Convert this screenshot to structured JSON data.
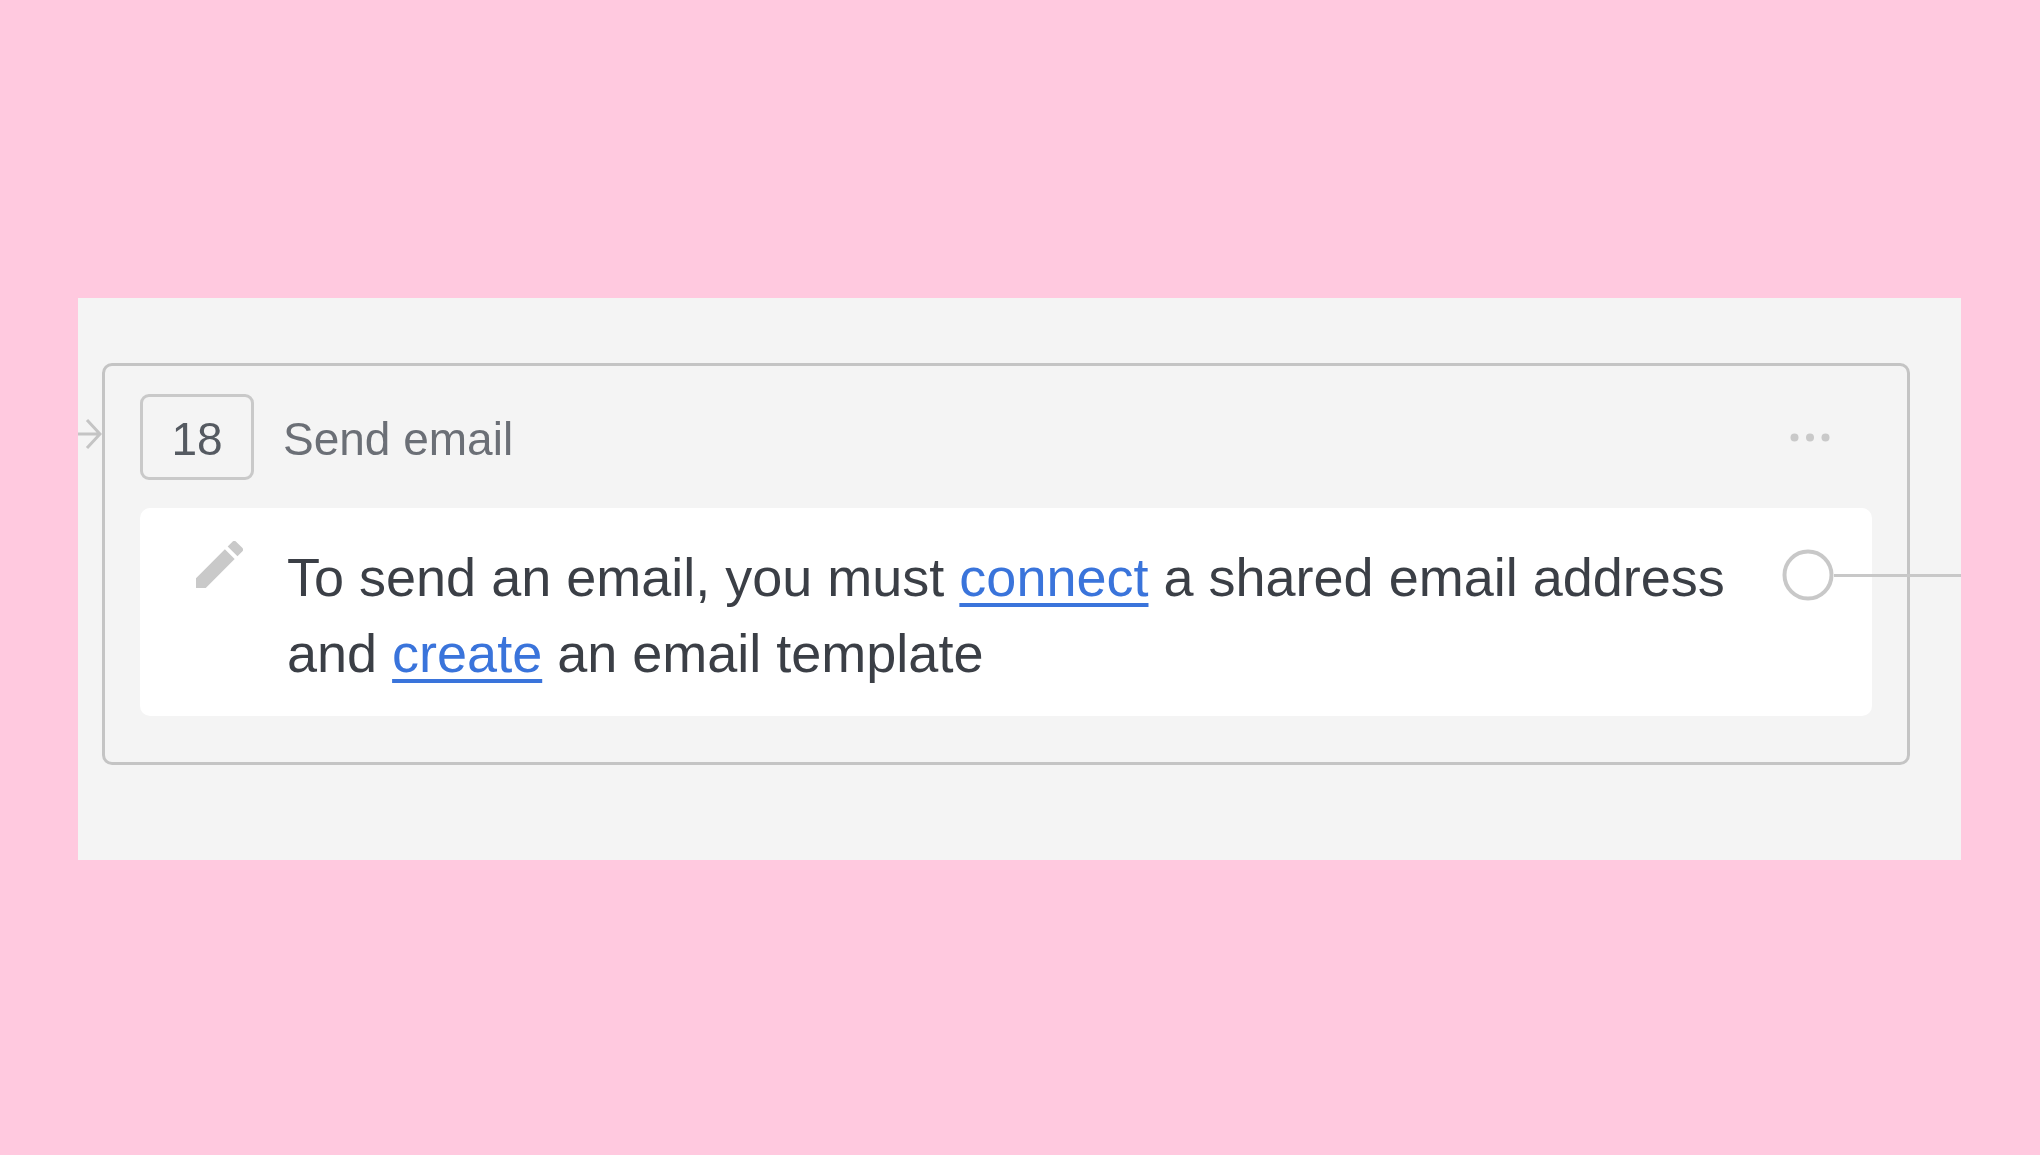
{
  "step": {
    "number": "18",
    "title": "Send email",
    "message": [
      {
        "kind": "text",
        "text": "To send an email, you must "
      },
      {
        "kind": "link",
        "text": "connect"
      },
      {
        "kind": "text",
        "text": " a shared email address and "
      },
      {
        "kind": "link",
        "text": "create"
      },
      {
        "kind": "text",
        "text": " an email template"
      }
    ]
  }
}
